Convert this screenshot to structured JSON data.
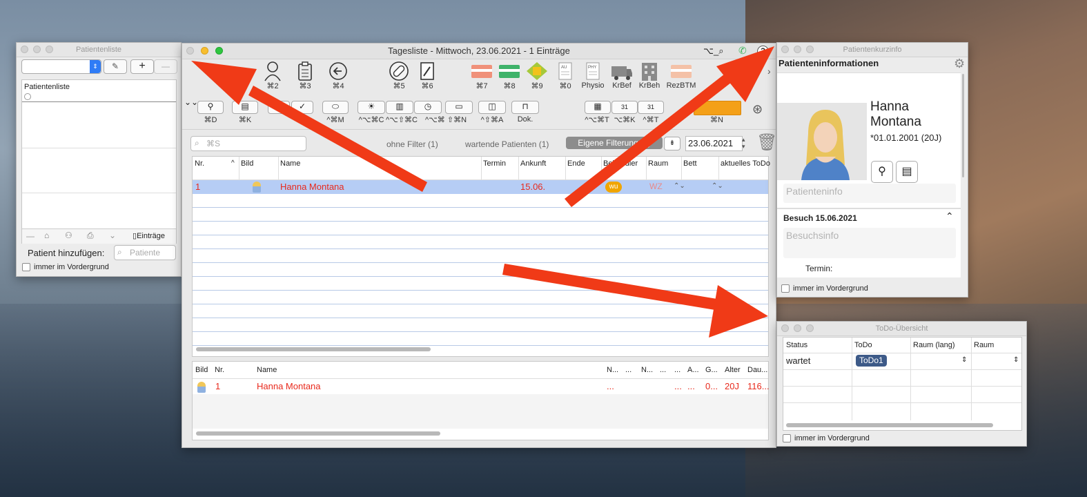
{
  "patientenliste": {
    "title": "Patientenliste",
    "list_header": "Patientenliste",
    "footer_count": "Einträge",
    "add_label": "Patient hinzufügen:",
    "search_placeholder": "Patiente",
    "foreground_label": "immer im Vordergrund"
  },
  "main": {
    "title": "Tagesliste - Mittwoch, 23.06.2021 - 1 Einträge",
    "toolbar1": [
      {
        "label": "⌘2",
        "icon": "person-icon"
      },
      {
        "label": "⌘3",
        "icon": "clipboard-icon"
      },
      {
        "label": "⌘4",
        "icon": "back-icon"
      },
      {
        "label": "⌘5",
        "icon": "pill-icon"
      },
      {
        "label": "⌘6",
        "icon": "doc-pen-icon"
      },
      {
        "label": "⌘7",
        "icon": "card-red-icon"
      },
      {
        "label": "⌘8",
        "icon": "card-green-icon"
      },
      {
        "label": "⌘9",
        "icon": "shape-icon"
      },
      {
        "label": "⌘0",
        "icon": "au-doc-icon"
      },
      {
        "label": "Physio",
        "icon": "physio-doc-icon"
      },
      {
        "label": "KrBef",
        "icon": "ambulance-icon"
      },
      {
        "label": "KrBeh",
        "icon": "hospital-icon"
      },
      {
        "label": "RezBTM",
        "icon": "btm-card-icon"
      }
    ],
    "toolbar2": [
      {
        "label": "⌘D"
      },
      {
        "label": "⌘K"
      },
      {
        "label": "^⌘M"
      },
      {
        "label": "^⌥⌘C"
      },
      {
        "label": "^⌥⇧⌘C"
      },
      {
        "label": "^⌥⌘ ⇧⌘N"
      },
      {
        "label": "^⇧⌘A"
      },
      {
        "label": "Dok."
      },
      {
        "label": "^⌥⌘T"
      },
      {
        "label": "⌥⌘K"
      },
      {
        "label": "^⌘T"
      },
      {
        "label": "⌘N"
      }
    ],
    "search_placeholder": "⌘S",
    "filter_none": "ohne Filter (1)",
    "filter_waiting": "wartende Patienten (1)",
    "filter_own": "Eigene Filterung (1)",
    "date": "23.06.2021",
    "columns": [
      "Nr.",
      "Bild",
      "Name",
      "Termin",
      "Ankunft",
      "Ende",
      "Behandler",
      "Raum",
      "Bett",
      "aktuelles ToDo"
    ],
    "row": {
      "nr": "1",
      "name": "Hanna Montana",
      "ankunft": "15.06.",
      "behandler": "wu",
      "raum": "WZ"
    },
    "bottom_columns": [
      "Bild",
      "Nr.",
      "Name",
      "N...",
      "...",
      "N...",
      "...",
      "...",
      "A...",
      "G...",
      "Alter",
      "Dau..."
    ],
    "bottom_row": {
      "nr": "1",
      "name": "Hanna Montana",
      "c1": "...",
      "c2": "...",
      "c3": "...",
      "c4": "0...",
      "alter": "20J",
      "dauer": "116..."
    }
  },
  "kurzinfo": {
    "title": "Patientenkurzinfo",
    "header": "Patienteninformationen",
    "first_name": "Hanna",
    "last_name": "Montana",
    "birth": "*01.01.2001 (20J)",
    "patinfo_placeholder": "Patienteninfo",
    "visit_title": "Besuch 15.06.2021",
    "visit_placeholder": "Besuchsinfo",
    "termin_label": "Termin:",
    "foreground_label": "immer im Vordergrund"
  },
  "todo": {
    "title": "ToDo-Übersicht",
    "columns": [
      "Status",
      "ToDo",
      "Raum (lang)",
      "Raum"
    ],
    "row": {
      "status": "wartet",
      "todo": "ToDo1"
    },
    "foreground_label": "immer im Vordergrund"
  },
  "colors": {
    "arrow": "#f03a17",
    "patient_red": "#e8291c",
    "selection": "#b6cdf5",
    "badge": "#f0a500"
  }
}
